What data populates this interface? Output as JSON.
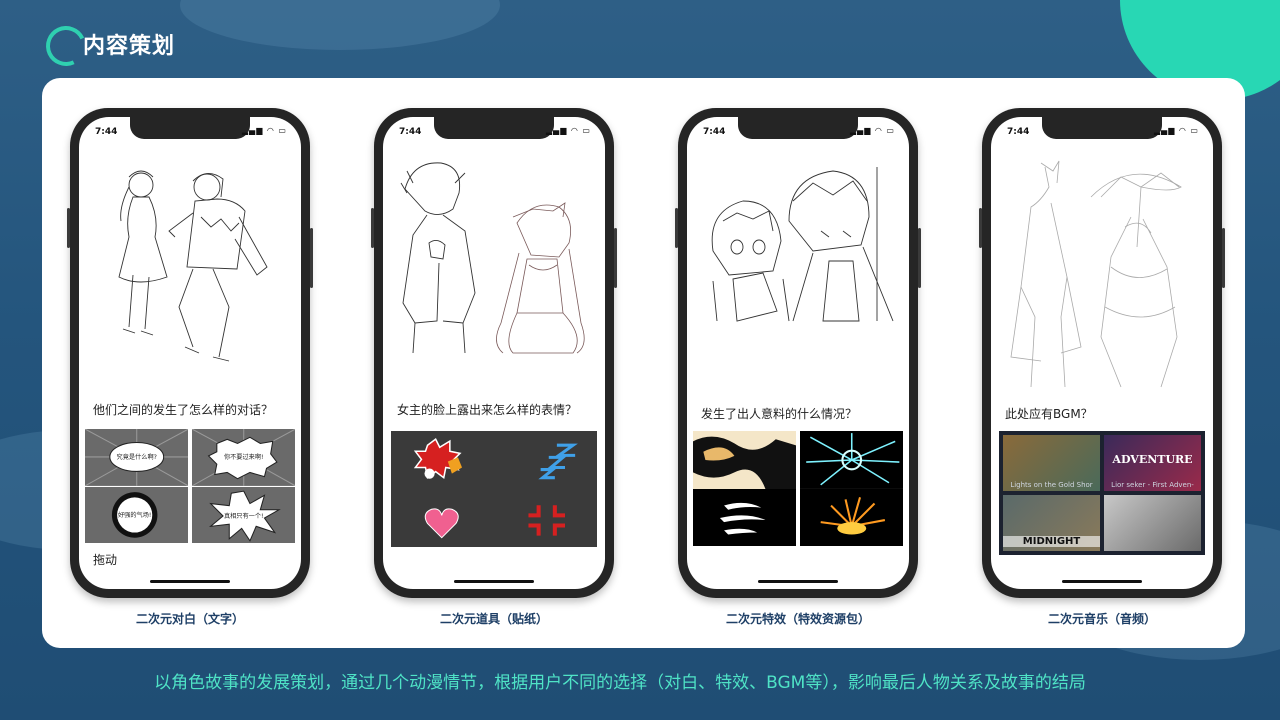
{
  "header": {
    "title": "内容策划"
  },
  "phones": [
    {
      "status_time": "7:44",
      "question": "他们之间的发生了怎么样的对话？",
      "bubbles": [
        "究竟是什么啊?",
        "你不要过来啊!",
        "好强的气场!",
        "真相只有一个!"
      ],
      "extra": "拖动",
      "caption": "二次元对白（文字）"
    },
    {
      "status_time": "7:44",
      "question": "女主的脸上露出来怎么样的表情？",
      "caption": "二次元道具（贴纸）"
    },
    {
      "status_time": "7:44",
      "question": "发生了出人意料的什么情况？",
      "caption": "二次元特效（特效资源包）"
    },
    {
      "status_time": "7:44",
      "question": "此处应有BGM？",
      "tracks": [
        "Lights on the Gold Shor",
        "Lior seker - First Adven-"
      ],
      "thumb_texts": [
        "ADVENTURE",
        "MIDNIGHT"
      ],
      "caption": "二次元音乐（音频）"
    }
  ],
  "footer": {
    "text": "以角色故事的发展策划，通过几个动漫情节，根据用户不同的选择（对白、特效、BGM等），影响最后人物关系及故事的结局"
  },
  "colors": {
    "accent": "#2fd0b0",
    "caption": "#1e3f66",
    "footer": "#4fe3c6"
  }
}
